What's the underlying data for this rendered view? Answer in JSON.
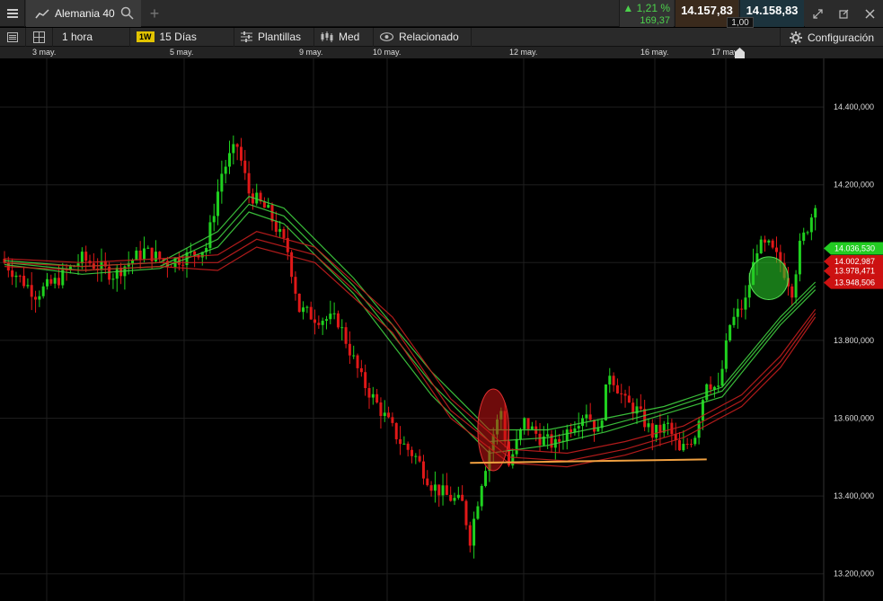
{
  "header": {
    "instrument": "Alemania 40",
    "change_pct": "▲ 1,21 %",
    "change_abs": "169,37",
    "sell_price": "14.157,83",
    "buy_price": "14.158,83",
    "spread": "1,00"
  },
  "toolbar": {
    "interval": "1 hora",
    "badge": "1W",
    "range": "15 Días",
    "templates": "Plantillas",
    "price_type": "Med",
    "related": "Relacionado",
    "settings": "Configuración"
  },
  "icons": [
    "menu-icon",
    "line-chart-icon",
    "search-icon",
    "add-tab-icon",
    "list-icon",
    "layout-grid-icon",
    "candlestick-icon",
    "eye-icon",
    "gear-icon",
    "expand-icon",
    "popout-icon",
    "close-icon",
    "marker-icon"
  ],
  "colors": {
    "up": "#1fd11f",
    "down": "#e01818",
    "ma_green": "#3fcf3f",
    "ma_red": "#c41e1e",
    "support_line": "#f0a040",
    "grid": "#1e1e1e"
  },
  "chart_data": {
    "type": "candlestick",
    "x_labels": [
      "3 may.",
      "5 may.",
      "9 may.",
      "10 may.",
      "12 may.",
      "16 may.",
      "17 may."
    ],
    "y_ticks": [
      "14.400,000",
      "14.200,000",
      "14.000,000",
      "13.800,000",
      "13.600,000",
      "13.400,000",
      "13.200,000"
    ],
    "y_tick_values": [
      14400,
      14200,
      14000,
      13800,
      13600,
      13400,
      13200
    ],
    "ylim": [
      13130,
      14525
    ],
    "x_count": 210,
    "grid": true,
    "price_tags": [
      {
        "label": "14.036,530",
        "value": 14036.53,
        "color": "#22cc22"
      },
      {
        "label": "14.002,987",
        "value": 14002.99,
        "color": "#cc1111"
      },
      {
        "label": "13.978,471",
        "value": 13978.47,
        "color": "#cc1111"
      },
      {
        "label": "13.948,506",
        "value": 13948.51,
        "color": "#cc1111"
      }
    ],
    "close_path": [
      [
        0,
        14000
      ],
      [
        8,
        13920
      ],
      [
        13,
        13950
      ],
      [
        20,
        14010
      ],
      [
        28,
        13970
      ],
      [
        36,
        14030
      ],
      [
        42,
        14000
      ],
      [
        48,
        14020
      ],
      [
        52,
        14040
      ],
      [
        56,
        14230
      ],
      [
        58,
        14270
      ],
      [
        60,
        14300
      ],
      [
        63,
        14180
      ],
      [
        68,
        14130
      ],
      [
        73,
        14030
      ],
      [
        76,
        13880
      ],
      [
        80,
        13860
      ],
      [
        86,
        13850
      ],
      [
        92,
        13700
      ],
      [
        97,
        13620
      ],
      [
        102,
        13540
      ],
      [
        106,
        13500
      ],
      [
        110,
        13430
      ],
      [
        114,
        13400
      ],
      [
        118,
        13380
      ],
      [
        120,
        13290
      ],
      [
        123,
        13440
      ],
      [
        126,
        13560
      ],
      [
        128,
        13620
      ],
      [
        130,
        13480
      ],
      [
        134,
        13590
      ],
      [
        138,
        13550
      ],
      [
        142,
        13530
      ],
      [
        146,
        13580
      ],
      [
        150,
        13620
      ],
      [
        153,
        13560
      ],
      [
        156,
        13720
      ],
      [
        160,
        13640
      ],
      [
        163,
        13620
      ],
      [
        167,
        13560
      ],
      [
        171,
        13580
      ],
      [
        174,
        13510
      ],
      [
        178,
        13560
      ],
      [
        181,
        13700
      ],
      [
        184,
        13670
      ],
      [
        187,
        13840
      ],
      [
        191,
        13900
      ],
      [
        194,
        14040
      ],
      [
        197,
        14040
      ],
      [
        200,
        14000
      ],
      [
        203,
        13930
      ],
      [
        205,
        14040
      ],
      [
        208,
        14120
      ],
      [
        209,
        14160
      ]
    ],
    "moving_averages": [
      {
        "color": "green",
        "points": [
          [
            0,
            14005
          ],
          [
            20,
            13990
          ],
          [
            40,
            14000
          ],
          [
            55,
            14080
          ],
          [
            63,
            14170
          ],
          [
            72,
            14140
          ],
          [
            90,
            13960
          ],
          [
            110,
            13720
          ],
          [
            125,
            13570
          ],
          [
            140,
            13570
          ],
          [
            155,
            13600
          ],
          [
            170,
            13630
          ],
          [
            185,
            13680
          ],
          [
            200,
            13860
          ],
          [
            209,
            13950
          ]
        ]
      },
      {
        "color": "green",
        "points": [
          [
            0,
            14000
          ],
          [
            20,
            13980
          ],
          [
            40,
            13990
          ],
          [
            55,
            14060
          ],
          [
            63,
            14150
          ],
          [
            72,
            14120
          ],
          [
            90,
            13940
          ],
          [
            110,
            13690
          ],
          [
            125,
            13540
          ],
          [
            140,
            13550
          ],
          [
            155,
            13580
          ],
          [
            170,
            13620
          ],
          [
            185,
            13670
          ],
          [
            200,
            13850
          ],
          [
            209,
            13940
          ]
        ]
      },
      {
        "color": "green",
        "points": [
          [
            0,
            13995
          ],
          [
            20,
            13970
          ],
          [
            40,
            13985
          ],
          [
            55,
            14040
          ],
          [
            63,
            14130
          ],
          [
            72,
            14100
          ],
          [
            90,
            13920
          ],
          [
            110,
            13660
          ],
          [
            125,
            13510
          ],
          [
            140,
            13530
          ],
          [
            155,
            13565
          ],
          [
            170,
            13610
          ],
          [
            185,
            13655
          ],
          [
            200,
            13840
          ],
          [
            209,
            13930
          ]
        ]
      },
      {
        "color": "red",
        "points": [
          [
            0,
            14010
          ],
          [
            20,
            14000
          ],
          [
            40,
            14010
          ],
          [
            55,
            14020
          ],
          [
            65,
            14080
          ],
          [
            80,
            14040
          ],
          [
            100,
            13860
          ],
          [
            115,
            13650
          ],
          [
            130,
            13520
          ],
          [
            145,
            13510
          ],
          [
            160,
            13540
          ],
          [
            175,
            13580
          ],
          [
            190,
            13660
          ],
          [
            200,
            13760
          ],
          [
            209,
            13880
          ]
        ]
      },
      {
        "color": "red",
        "points": [
          [
            0,
            14000
          ],
          [
            20,
            13990
          ],
          [
            40,
            14000
          ],
          [
            55,
            14000
          ],
          [
            65,
            14060
          ],
          [
            80,
            14020
          ],
          [
            100,
            13840
          ],
          [
            115,
            13620
          ],
          [
            130,
            13500
          ],
          [
            145,
            13490
          ],
          [
            160,
            13520
          ],
          [
            175,
            13565
          ],
          [
            190,
            13645
          ],
          [
            200,
            13745
          ],
          [
            209,
            13870
          ]
        ]
      },
      {
        "color": "red",
        "points": [
          [
            0,
            13990
          ],
          [
            20,
            13980
          ],
          [
            40,
            13990
          ],
          [
            55,
            13980
          ],
          [
            65,
            14040
          ],
          [
            80,
            14000
          ],
          [
            100,
            13820
          ],
          [
            115,
            13600
          ],
          [
            130,
            13485
          ],
          [
            145,
            13475
          ],
          [
            160,
            13505
          ],
          [
            175,
            13550
          ],
          [
            190,
            13630
          ],
          [
            200,
            13730
          ],
          [
            209,
            13860
          ]
        ]
      }
    ],
    "annotations": [
      {
        "type": "ellipse",
        "color": "red",
        "x": 126,
        "y": 13570,
        "rx_bars": 4,
        "ry_value": 105
      },
      {
        "type": "ellipse",
        "color": "green",
        "x": 197,
        "y": 13960,
        "rx_bars": 5,
        "ry_value": 55
      },
      {
        "type": "horizontal-line",
        "color": "orange",
        "x_start": 120,
        "x_end": 181,
        "y_start": 13485,
        "y_end": 13494
      }
    ]
  }
}
